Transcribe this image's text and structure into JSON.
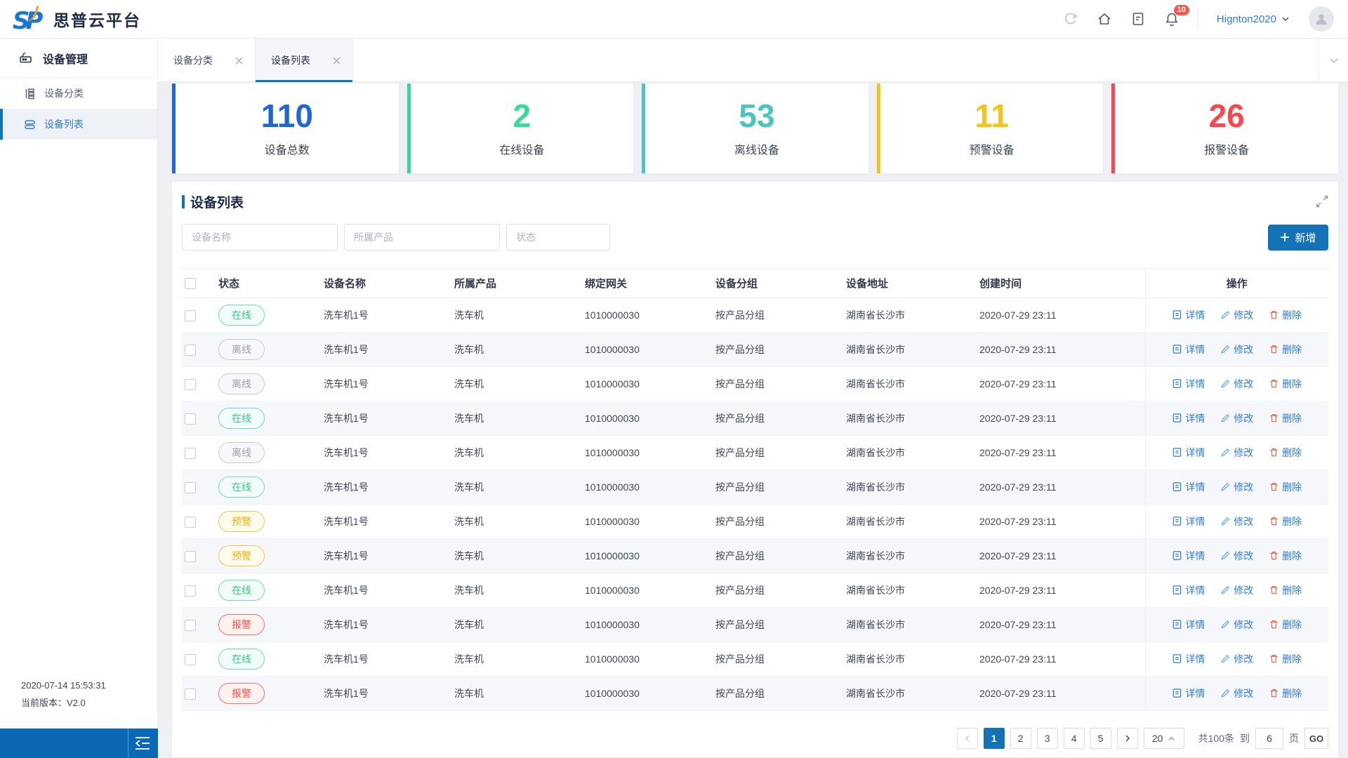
{
  "brand": {
    "logo_text": "SP",
    "app_name": "思普云平台"
  },
  "topbar": {
    "username": "Hignton2020",
    "notification_count": "10",
    "icons": [
      "refresh-icon",
      "home-icon",
      "document-icon",
      "bell-icon",
      "chevron-down-icon",
      "avatar"
    ]
  },
  "sidebar": {
    "group_label": "设备管理",
    "group_icon": "device-icon",
    "items": [
      {
        "label": "设备分类",
        "icon": "category-icon",
        "active": false
      },
      {
        "label": "设备列表",
        "icon": "list-icon",
        "active": true
      }
    ],
    "footer": {
      "timestamp": "2020-07-14 15:53:31",
      "version": "当前版本：V2.0"
    }
  },
  "tabs": [
    {
      "label": "设备分类",
      "active": false
    },
    {
      "label": "设备列表",
      "active": true
    }
  ],
  "stats": [
    {
      "value": "110",
      "label": "设备总数",
      "color": "#2166D2"
    },
    {
      "value": "2",
      "label": "在线设备",
      "color": "#3BD89E"
    },
    {
      "value": "53",
      "label": "离线设备",
      "color": "#4BC6BE"
    },
    {
      "value": "11",
      "label": "预警设备",
      "color": "#F3C41D"
    },
    {
      "value": "26",
      "label": "报警设备",
      "color": "#F8484E"
    }
  ],
  "panel": {
    "title": "设备列表",
    "filters": [
      {
        "placeholder": "设备名称"
      },
      {
        "placeholder": "所属产品"
      },
      {
        "placeholder": "状态"
      }
    ],
    "add_button_label": "新增"
  },
  "table": {
    "columns": [
      "状态",
      "设备名称",
      "所属产品",
      "绑定网关",
      "设备分组",
      "设备地址",
      "创建时间",
      "操作"
    ],
    "actions": {
      "detail": "详情",
      "edit": "修改",
      "delete": "删除"
    },
    "status_colors": {
      "online": {
        "label": "在线",
        "color": "#34C78F"
      },
      "offline": {
        "label": "离线",
        "color": "#9AA1AC"
      },
      "warning": {
        "label": "预警",
        "color": "#E9B50E"
      },
      "alarm": {
        "label": "报警",
        "color": "#F4504E"
      }
    },
    "rows": [
      {
        "status": "在线",
        "status_type": "online",
        "name": "洗车机1号",
        "product": "洗车机",
        "gateway": "1010000030",
        "group": "按产品分组",
        "address": "湖南省长沙市",
        "created": "2020-07-29 23:11"
      },
      {
        "status": "离线",
        "status_type": "offline",
        "name": "洗车机1号",
        "product": "洗车机",
        "gateway": "1010000030",
        "group": "按产品分组",
        "address": "湖南省长沙市",
        "created": "2020-07-29 23:11"
      },
      {
        "status": "离线",
        "status_type": "offline",
        "name": "洗车机1号",
        "product": "洗车机",
        "gateway": "1010000030",
        "group": "按产品分组",
        "address": "湖南省长沙市",
        "created": "2020-07-29 23:11"
      },
      {
        "status": "在线",
        "status_type": "online",
        "name": "洗车机1号",
        "product": "洗车机",
        "gateway": "1010000030",
        "group": "按产品分组",
        "address": "湖南省长沙市",
        "created": "2020-07-29 23:11"
      },
      {
        "status": "离线",
        "status_type": "offline",
        "name": "洗车机1号",
        "product": "洗车机",
        "gateway": "1010000030",
        "group": "按产品分组",
        "address": "湖南省长沙市",
        "created": "2020-07-29 23:11"
      },
      {
        "status": "在线",
        "status_type": "online",
        "name": "洗车机1号",
        "product": "洗车机",
        "gateway": "1010000030",
        "group": "按产品分组",
        "address": "湖南省长沙市",
        "created": "2020-07-29 23:11"
      },
      {
        "status": "预警",
        "status_type": "warning",
        "name": "洗车机1号",
        "product": "洗车机",
        "gateway": "1010000030",
        "group": "按产品分组",
        "address": "湖南省长沙市",
        "created": "2020-07-29 23:11"
      },
      {
        "status": "预警",
        "status_type": "warning",
        "name": "洗车机1号",
        "product": "洗车机",
        "gateway": "1010000030",
        "group": "按产品分组",
        "address": "湖南省长沙市",
        "created": "2020-07-29 23:11"
      },
      {
        "status": "在线",
        "status_type": "online",
        "name": "洗车机1号",
        "product": "洗车机",
        "gateway": "1010000030",
        "group": "按产品分组",
        "address": "湖南省长沙市",
        "created": "2020-07-29 23:11"
      },
      {
        "status": "报警",
        "status_type": "alarm",
        "name": "洗车机1号",
        "product": "洗车机",
        "gateway": "1010000030",
        "group": "按产品分组",
        "address": "湖南省长沙市",
        "created": "2020-07-29 23:11"
      },
      {
        "status": "在线",
        "status_type": "online",
        "name": "洗车机1号",
        "product": "洗车机",
        "gateway": "1010000030",
        "group": "按产品分组",
        "address": "湖南省长沙市",
        "created": "2020-07-29 23:11"
      },
      {
        "status": "报警",
        "status_type": "alarm",
        "name": "洗车机1号",
        "product": "洗车机",
        "gateway": "1010000030",
        "group": "按产品分组",
        "address": "湖南省长沙市",
        "created": "2020-07-29 23:11"
      }
    ]
  },
  "pagination": {
    "pages": [
      "1",
      "2",
      "3",
      "4",
      "5"
    ],
    "active_page": "1",
    "page_size": "20",
    "total_label": "共100条",
    "to_label": "到",
    "goto_value": "6",
    "page_unit_label": "页",
    "go_label": "GO"
  },
  "colors": {
    "accent_blue": "#1373B6",
    "link_blue": "#2E7CD5",
    "badge_red": "#F45A4C"
  }
}
